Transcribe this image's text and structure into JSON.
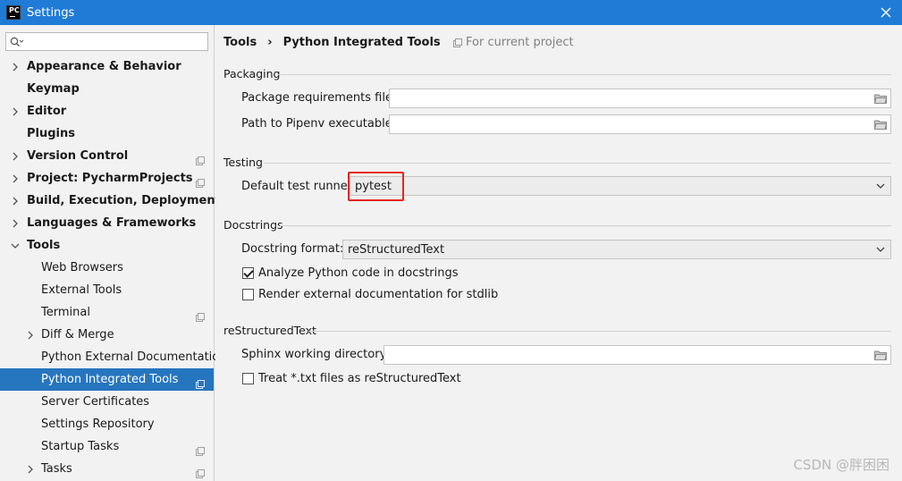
{
  "window": {
    "title": "Settings",
    "logo_text": "PC"
  },
  "search": {
    "value": "",
    "placeholder": ""
  },
  "sidebar": {
    "items": [
      {
        "label": "Appearance & Behavior",
        "level": 0,
        "expandable": true,
        "expanded": false,
        "project_icon": false,
        "selected": false
      },
      {
        "label": "Keymap",
        "level": 0,
        "expandable": false,
        "expanded": false,
        "project_icon": false,
        "selected": false
      },
      {
        "label": "Editor",
        "level": 0,
        "expandable": true,
        "expanded": false,
        "project_icon": false,
        "selected": false
      },
      {
        "label": "Plugins",
        "level": 0,
        "expandable": false,
        "expanded": false,
        "project_icon": false,
        "selected": false
      },
      {
        "label": "Version Control",
        "level": 0,
        "expandable": true,
        "expanded": false,
        "project_icon": true,
        "selected": false
      },
      {
        "label": "Project: PycharmProjects",
        "level": 0,
        "expandable": true,
        "expanded": false,
        "project_icon": true,
        "selected": false
      },
      {
        "label": "Build, Execution, Deployment",
        "level": 0,
        "expandable": true,
        "expanded": false,
        "project_icon": false,
        "selected": false
      },
      {
        "label": "Languages & Frameworks",
        "level": 0,
        "expandable": true,
        "expanded": false,
        "project_icon": false,
        "selected": false
      },
      {
        "label": "Tools",
        "level": 0,
        "expandable": true,
        "expanded": true,
        "project_icon": false,
        "selected": false
      },
      {
        "label": "Web Browsers",
        "level": 1,
        "expandable": false,
        "expanded": false,
        "project_icon": false,
        "selected": false
      },
      {
        "label": "External Tools",
        "level": 1,
        "expandable": false,
        "expanded": false,
        "project_icon": false,
        "selected": false
      },
      {
        "label": "Terminal",
        "level": 1,
        "expandable": false,
        "expanded": false,
        "project_icon": true,
        "selected": false
      },
      {
        "label": "Diff & Merge",
        "level": 1,
        "expandable": true,
        "expanded": false,
        "project_icon": false,
        "selected": false
      },
      {
        "label": "Python External Documentation",
        "level": 1,
        "expandable": false,
        "expanded": false,
        "project_icon": false,
        "selected": false
      },
      {
        "label": "Python Integrated Tools",
        "level": 1,
        "expandable": false,
        "expanded": false,
        "project_icon": true,
        "selected": true
      },
      {
        "label": "Server Certificates",
        "level": 1,
        "expandable": false,
        "expanded": false,
        "project_icon": false,
        "selected": false
      },
      {
        "label": "Settings Repository",
        "level": 1,
        "expandable": false,
        "expanded": false,
        "project_icon": false,
        "selected": false
      },
      {
        "label": "Startup Tasks",
        "level": 1,
        "expandable": false,
        "expanded": false,
        "project_icon": true,
        "selected": false
      },
      {
        "label": "Tasks",
        "level": 1,
        "expandable": true,
        "expanded": false,
        "project_icon": true,
        "selected": false
      }
    ]
  },
  "main": {
    "breadcrumb": [
      "Tools",
      "Python Integrated Tools"
    ],
    "breadcrumb_sep": "›",
    "scope_label": "For current project",
    "packaging": {
      "title": "Packaging",
      "requirements_label": "Package requirements file:",
      "requirements_value": "",
      "pipenv_label": "Path to Pipenv executable:",
      "pipenv_value": ""
    },
    "testing": {
      "title": "Testing",
      "runner_label": "Default test runner:",
      "runner_value": "pytest"
    },
    "docstrings": {
      "title": "Docstrings",
      "format_label": "Docstring format:",
      "format_value": "reStructuredText",
      "analyze_label": "Analyze Python code in docstrings",
      "analyze_checked": true,
      "render_label": "Render external documentation for stdlib",
      "render_checked": false
    },
    "restructuredtext": {
      "title": "reStructuredText",
      "sphinx_label": "Sphinx working directory:",
      "sphinx_value": "",
      "treat_label": "Treat *.txt files as reStructuredText",
      "treat_checked": false
    }
  },
  "watermark": "CSDN @胖困困",
  "colors": {
    "titlebar": "#1f7bd6",
    "selection": "#2675bf",
    "highlight_box": "#e8231e"
  }
}
